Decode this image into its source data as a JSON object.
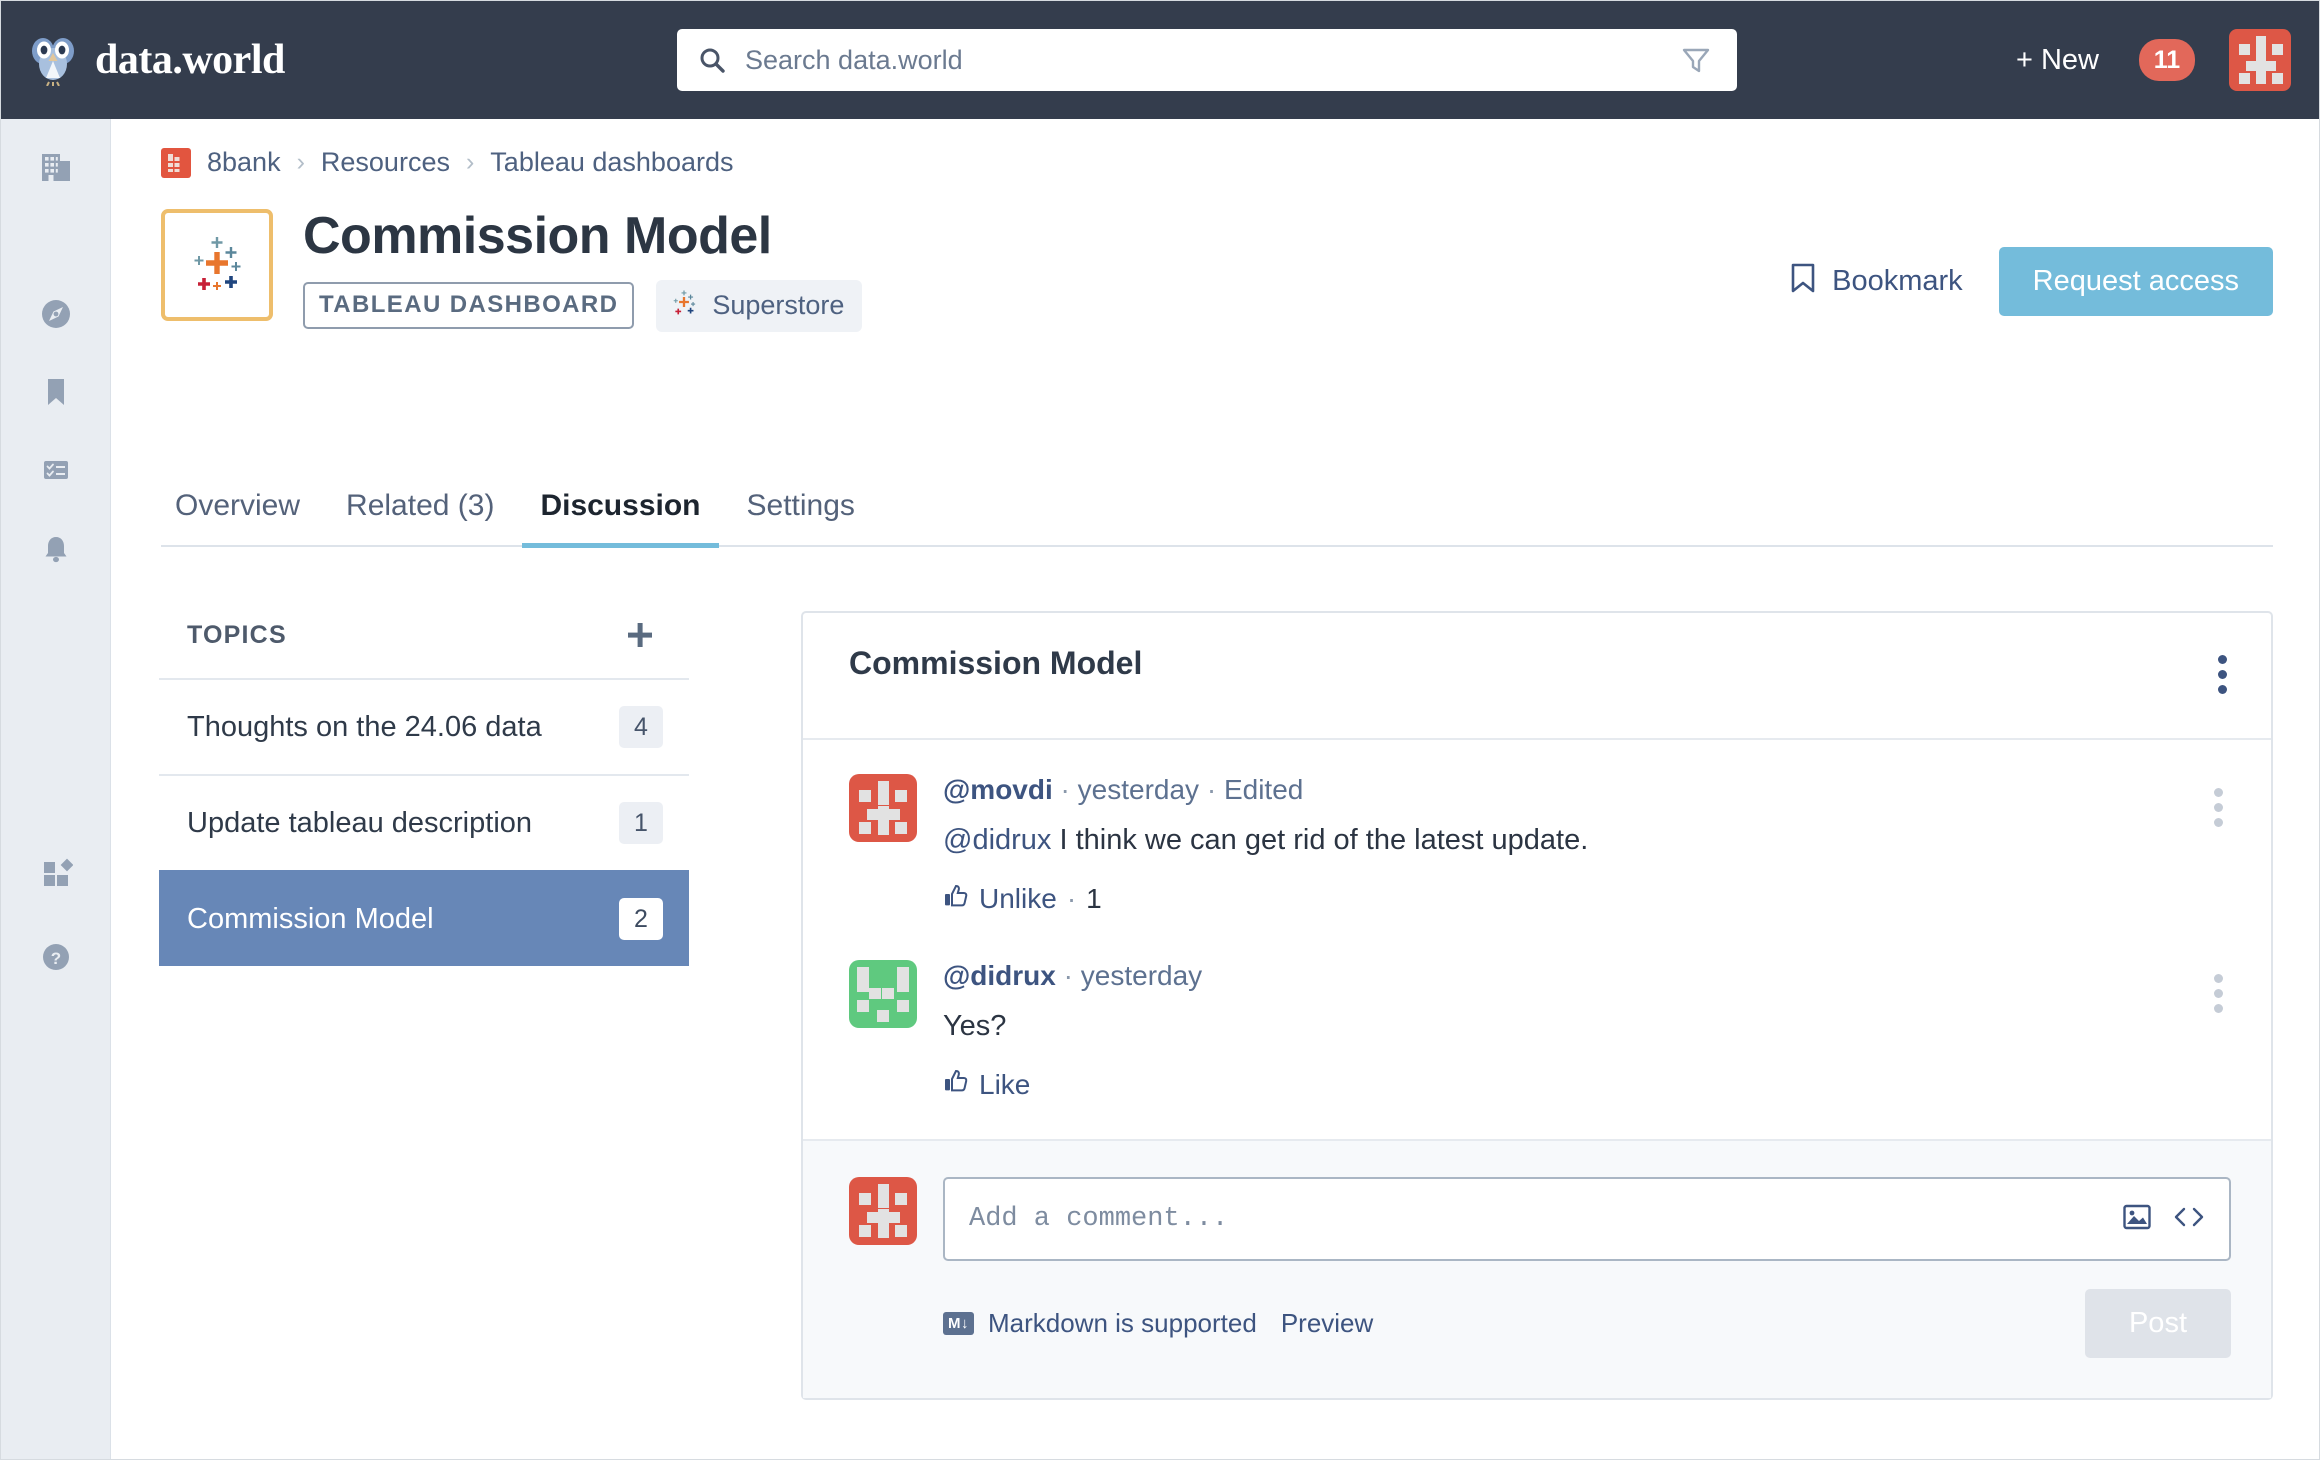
{
  "header": {
    "brand": "data.world",
    "brand_icon": "owl-icon",
    "search": {
      "placeholder": "Search data.world",
      "value": "",
      "icon": "search-icon",
      "filter_icon": "filter-icon"
    },
    "new_label": "+ New",
    "notification_count": "11",
    "avatar_name": "user-avatar",
    "bg_color": "#343d4d"
  },
  "rail": {
    "items": [
      {
        "name": "organizations-icon",
        "label": "Organizations"
      },
      {
        "name": "explore-compass-icon",
        "label": "Explore"
      },
      {
        "name": "bookmarks-icon",
        "label": "Bookmarks"
      },
      {
        "name": "projects-checklist-icon",
        "label": "Projects"
      },
      {
        "name": "notifications-bell-icon",
        "label": "Notifications"
      }
    ],
    "bottom_items": [
      {
        "name": "integrations-apps-icon",
        "label": "Integrations"
      },
      {
        "name": "help-question-icon",
        "label": "Help"
      }
    ]
  },
  "breadcrumb": {
    "org_icon": "8bank-org-icon",
    "items": [
      "8bank",
      "Resources",
      "Tableau dashboards"
    ],
    "separator": "›"
  },
  "resource": {
    "title": "Commission Model",
    "icon": "tableau-icon",
    "type_badge": "TABLEAU DASHBOARD",
    "source_badge": "Superstore",
    "source_icon": "tableau-small-icon",
    "icon_border_color": "#eebe6c"
  },
  "actions": {
    "bookmark_label": "Bookmark",
    "bookmark_icon": "bookmark-icon",
    "request_label": "Request access",
    "request_color": "#74bcdb"
  },
  "tabs": [
    {
      "label": "Overview",
      "active": false
    },
    {
      "label": "Related (3)",
      "active": false
    },
    {
      "label": "Discussion",
      "active": true
    },
    {
      "label": "Settings",
      "active": false
    }
  ],
  "topics": {
    "header": "TOPICS",
    "add_icon": "plus-icon",
    "items": [
      {
        "label": "Thoughts on the 24.06 data",
        "count": "4",
        "selected": false
      },
      {
        "label": "Update tableau description",
        "count": "1",
        "selected": false
      },
      {
        "label": "Commission Model",
        "count": "2",
        "selected": true
      }
    ],
    "selected_color": "#6787b7"
  },
  "discussion": {
    "title": "Commission Model",
    "menu_icon": "kebab-menu-icon",
    "comments": [
      {
        "author": "@movdi",
        "time": "yesterday",
        "edited": "Edited",
        "separator": "·",
        "mention": "@didrux",
        "text": " I think we can get rid of the latest update.",
        "like_label": "Unlike",
        "like_count": "1",
        "like_icon": "thumbs-up-icon",
        "avatar_color": "#dd5746",
        "avatar_name": "movdi-avatar"
      },
      {
        "author": "@didrux",
        "time": "yesterday",
        "edited": "",
        "separator": "·",
        "mention": "",
        "text": "Yes?",
        "like_label": "Like",
        "like_count": "",
        "like_icon": "thumbs-up-icon",
        "avatar_color": "#5fc97f",
        "avatar_name": "didrux-avatar"
      }
    ]
  },
  "composer": {
    "avatar_name": "current-user-avatar",
    "placeholder": "Add a comment...",
    "value": "",
    "image_icon": "insert-image-icon",
    "code_icon": "insert-code-icon",
    "markdown_badge": "M↓",
    "markdown_note": "Markdown is supported",
    "preview_label": "Preview",
    "post_label": "Post"
  }
}
